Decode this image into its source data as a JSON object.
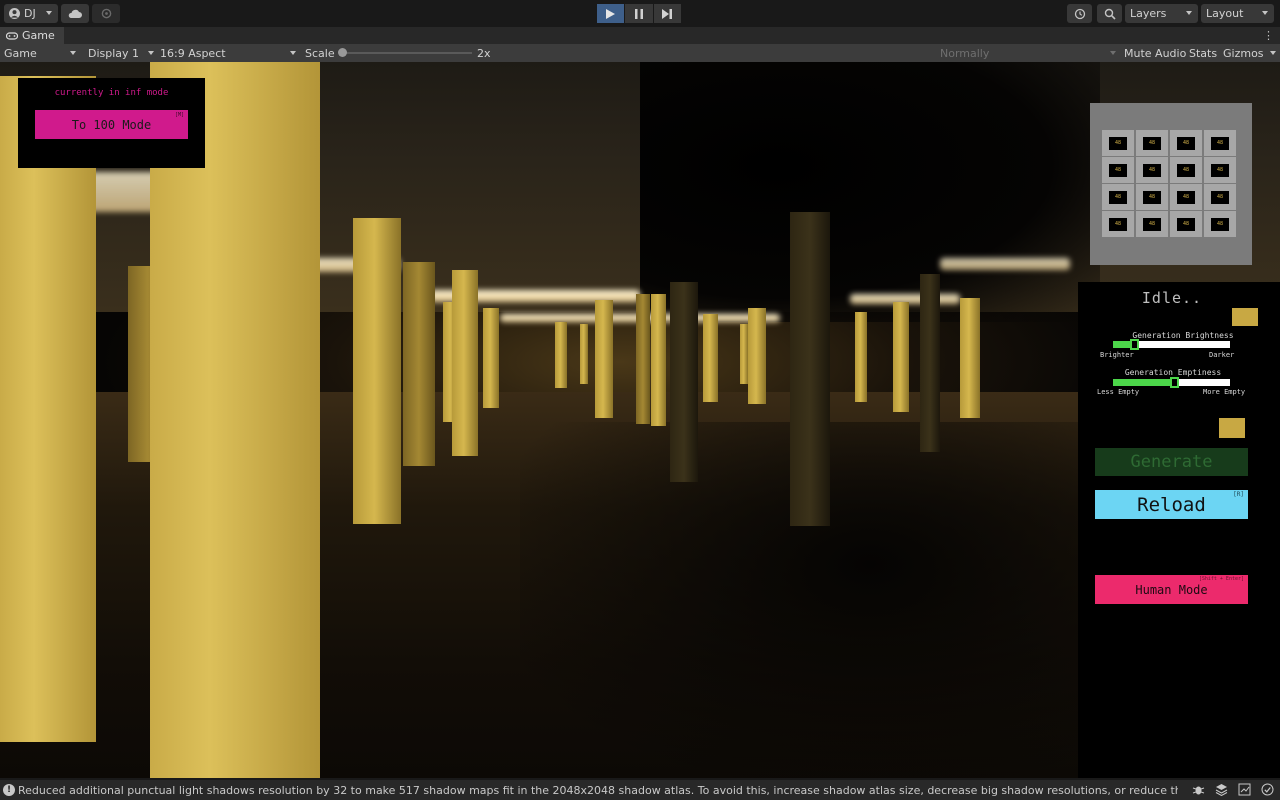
{
  "toolbar": {
    "account_label": "DJ",
    "layers_label": "Layers",
    "layout_label": "Layout",
    "play_state": "playing"
  },
  "tab": {
    "label": "Game"
  },
  "game_toolbar": {
    "view_select": "Game",
    "display_select": "Display 1",
    "aspect_select": "16:9 Aspect",
    "scale_label": "Scale",
    "scale_value": "2x",
    "vsync_select": "Normally",
    "mute_audio": "Mute Audio",
    "stats": "Stats",
    "gizmos": "Gizmos"
  },
  "game_ui": {
    "mode_text": "currently in inf mode",
    "mode_button": "To 100 Mode",
    "mode_button_hint": "[M]",
    "grid_cells": [
      "48",
      "48",
      "48",
      "48",
      "48",
      "48",
      "48",
      "48",
      "48",
      "48",
      "48",
      "48",
      "48",
      "48",
      "48",
      "48"
    ],
    "status": "Idle..",
    "brightness": {
      "label": "Generation Brightness",
      "min_label": "Brighter",
      "max_label": "Darker",
      "value": 0.18
    },
    "emptiness": {
      "label": "Generation Emptiness",
      "min_label": "Less Empty",
      "max_label": "More Empty",
      "value": 0.52
    },
    "generate_button": "Generate",
    "reload_button": "Reload",
    "reload_hint": "[R]",
    "human_button": "Human Mode",
    "human_hint": "[Shift + Enter]"
  },
  "statusbar": {
    "message": "Reduced additional punctual light shadows resolution by 32 to make 517 shadow maps fit in the 2048x2048 shadow atlas. To avoid this, increase shadow atlas size, decrease big shadow resolutions, or reduce the number of shado"
  },
  "colors": {
    "accent_pink": "#d01a8c",
    "reload_blue": "#6cd5f3",
    "human_pink": "#ec2a6c",
    "slider_green": "#4cd64a",
    "play_active": "#3e5f8a"
  },
  "icons": [
    "account-icon",
    "cloud-icon",
    "collab-icon",
    "play-icon",
    "pause-icon",
    "step-icon",
    "history-icon",
    "search-icon",
    "gamepad-icon",
    "info-icon",
    "bug-icon",
    "layers-stack-icon",
    "network-icon",
    "check-icon"
  ]
}
